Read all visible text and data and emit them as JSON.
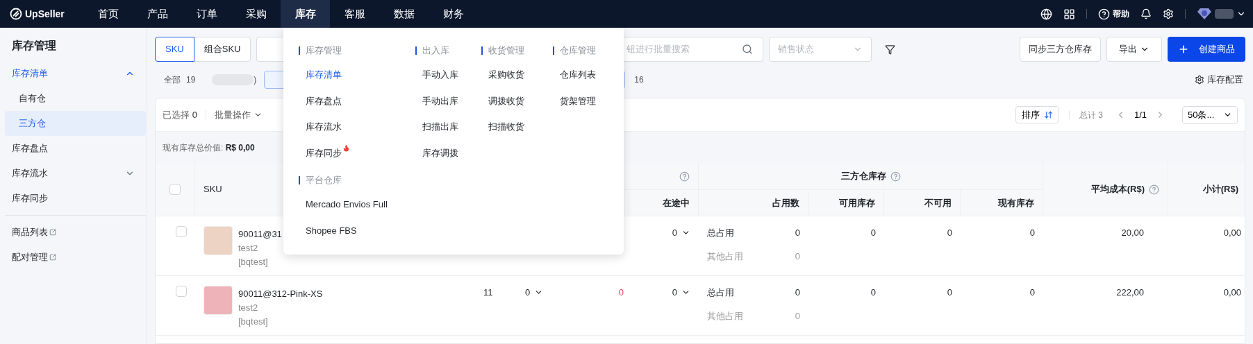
{
  "brand": {
    "name": "UpSeller"
  },
  "nav": [
    {
      "label": "首页",
      "selected": false
    },
    {
      "label": "产品",
      "selected": false
    },
    {
      "label": "订单",
      "selected": false
    },
    {
      "label": "采购",
      "selected": false
    },
    {
      "label": "库存",
      "selected": true
    },
    {
      "label": "客服",
      "selected": false
    },
    {
      "label": "数据",
      "selected": false
    },
    {
      "label": "财务",
      "selected": false
    }
  ],
  "header_actions": {
    "help": "帮助"
  },
  "nav_menu": {
    "columns": [
      {
        "sections": [
          {
            "title": "库存管理",
            "items": [
              {
                "label": "库存清单",
                "selected": true,
                "hot": false
              },
              {
                "label": "库存盘点",
                "selected": false,
                "hot": false
              },
              {
                "label": "库存流水",
                "selected": false,
                "hot": false
              },
              {
                "label": "库存同步",
                "selected": false,
                "hot": true
              }
            ]
          },
          {
            "title": "平台仓库",
            "items": [
              {
                "label": "Mercado Envios Full",
                "selected": false,
                "hot": false
              },
              {
                "label": "Shopee FBS",
                "selected": false,
                "hot": false
              }
            ]
          }
        ]
      },
      {
        "sections": [
          {
            "title": "出入库",
            "items": [
              {
                "label": "手动入库",
                "selected": false,
                "hot": false
              },
              {
                "label": "手动出库",
                "selected": false,
                "hot": false
              },
              {
                "label": "扫描出库",
                "selected": false,
                "hot": false
              },
              {
                "label": "库存调拨",
                "selected": false,
                "hot": false
              }
            ]
          }
        ]
      },
      {
        "sections": [
          {
            "title": "收货管理",
            "items": [
              {
                "label": "采购收货",
                "selected": false,
                "hot": false
              },
              {
                "label": "调拨收货",
                "selected": false,
                "hot": false
              },
              {
                "label": "扫描收货",
                "selected": false,
                "hot": false
              }
            ]
          }
        ]
      },
      {
        "sections": [
          {
            "title": "仓库管理",
            "items": [
              {
                "label": "仓库列表",
                "selected": false,
                "hot": false
              },
              {
                "label": "货架管理",
                "selected": false,
                "hot": false
              }
            ]
          }
        ]
      }
    ]
  },
  "sidebar": {
    "title": "库存管理",
    "groups": [
      {
        "items": [
          {
            "label": "库存清单",
            "kind": "group",
            "selected": true,
            "expanded": true,
            "children": [
              {
                "label": "自有仓",
                "selected": false
              },
              {
                "label": "三方仓",
                "selected": true
              }
            ]
          },
          {
            "label": "库存盘点",
            "kind": "page",
            "selected": false
          },
          {
            "label": "库存流水",
            "kind": "group",
            "selected": false,
            "expanded": false
          },
          {
            "label": "库存同步",
            "kind": "page",
            "selected": false
          }
        ]
      },
      {
        "items": [
          {
            "label": "商品列表",
            "kind": "external",
            "selected": false
          },
          {
            "label": "配对管理",
            "kind": "external",
            "selected": false
          }
        ]
      }
    ]
  },
  "filters": {
    "sku_mode_tabs": [
      {
        "label": "SKU",
        "selected": true
      },
      {
        "label": "组合SKU",
        "selected": false
      }
    ],
    "search": {
      "placeholder": "钮进行批量搜索"
    },
    "status_select": {
      "placeholder": "销售状态"
    },
    "sync_button": "同步三方仓库存",
    "export_button": "导出",
    "create_button": "创建商品"
  },
  "stock_tabs": [
    {
      "kind": "tab",
      "label": "全部",
      "count": "19",
      "selected": false
    },
    {
      "kind": "blurred",
      "count": ")",
      "selected": false
    },
    {
      "kind": "tab",
      "selected": true
    },
    {
      "kind": "tab",
      "count": "16",
      "selected": false
    }
  ],
  "config_link": "库存配置",
  "toolbar": {
    "selected_label": "已选择",
    "selected_count": "0",
    "batch": "批量操作",
    "sort": "排序",
    "total": "总计 3",
    "page": "1/1",
    "page_size": "50条..."
  },
  "summary": {
    "label": "现有库存总价值:",
    "value": "R$ 0,00"
  },
  "table": {
    "select_all_checked": false,
    "sku_header": "SKU",
    "group_1": {
      "help": true,
      "subcolumns": [
        "在途中"
      ]
    },
    "group_2": {
      "title": "三方仓库存",
      "help": true,
      "subcolumns": [
        "占用数",
        "可用库存",
        "不可用",
        "现有库存"
      ]
    },
    "avg_cost_header": "平均成本(R$)",
    "avg_cost_help": true,
    "subtotal_header": "小计(R$)",
    "rows": [
      {
        "selected": false,
        "sku": "90011@31",
        "name": "test2",
        "tag": "[bqtest]",
        "in_transit": "0",
        "occupancy": [
          {
            "label": "总占用",
            "value": "0"
          },
          {
            "label": "其他占用",
            "value": "0"
          }
        ],
        "available": "0",
        "unavailable": "0",
        "on_hand": "0",
        "avg_cost": "20,00",
        "subtotal": "0,00"
      },
      {
        "selected": false,
        "sku": "90011@312-Pink-XS",
        "name": "test2",
        "tag": "[bqtest]",
        "column_3": "11",
        "column_4": "0",
        "column_5": "0",
        "in_transit": "0",
        "occupancy": [
          {
            "label": "总占用",
            "value": "0"
          },
          {
            "label": "其他占用",
            "value": "0"
          }
        ],
        "available": "0",
        "unavailable": "0",
        "on_hand": "0",
        "avg_cost": "222,00",
        "subtotal": "0,00"
      }
    ]
  }
}
